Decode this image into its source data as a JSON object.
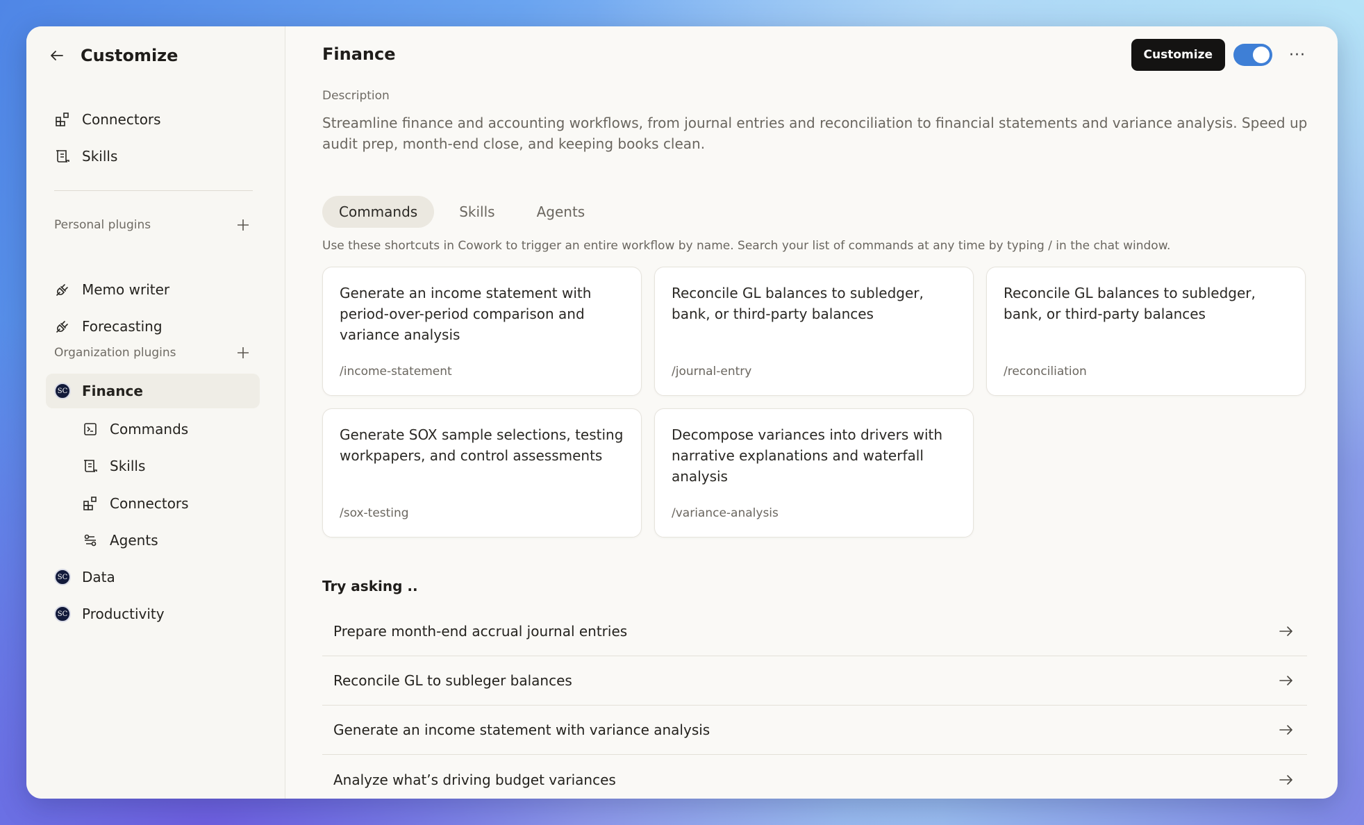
{
  "sidebar": {
    "title": "Customize",
    "top_items": [
      {
        "label": "Connectors",
        "icon": "connectors-icon"
      },
      {
        "label": "Skills",
        "icon": "skills-icon"
      }
    ],
    "personal": {
      "label": "Personal plugins",
      "items": [
        {
          "label": "Memo writer",
          "icon": "plug-icon"
        },
        {
          "label": "Forecasting",
          "icon": "plug-icon"
        }
      ]
    },
    "organization": {
      "label": "Organization plugins",
      "items": [
        {
          "label": "Finance",
          "badge": "SC",
          "active": true
        },
        {
          "label": "Data",
          "badge": "SC"
        },
        {
          "label": "Productivity",
          "badge": "SC"
        }
      ],
      "finance_sub": [
        {
          "label": "Commands",
          "icon": "commands-icon"
        },
        {
          "label": "Skills",
          "icon": "skills-icon"
        },
        {
          "label": "Connectors",
          "icon": "connectors-icon"
        },
        {
          "label": "Agents",
          "icon": "agents-icon"
        }
      ]
    }
  },
  "main": {
    "title": "Finance",
    "customize_label": "Customize",
    "toggle_on": true,
    "more_label": "···",
    "description_label": "Description",
    "description": "Streamline finance and accounting workflows, from journal entries and reconciliation to financial statements and variance analysis. Speed up audit prep, month-end close, and keeping books clean.",
    "tabs": [
      {
        "label": "Commands",
        "active": true
      },
      {
        "label": "Skills"
      },
      {
        "label": "Agents"
      }
    ],
    "tab_help": "Use these shortcuts in Cowork to trigger an entire workflow by name. Search your list of commands at any time by typing / in the chat window.",
    "cards": [
      {
        "desc": "Generate an income statement with period-over-period comparison and variance analysis",
        "cmd": "/income-statement"
      },
      {
        "desc": "Reconcile GL balances to subledger, bank, or third-party balances",
        "cmd": "/journal-entry"
      },
      {
        "desc": "Reconcile GL balances to subledger, bank, or third-party balances",
        "cmd": "/reconciliation"
      },
      {
        "desc": "Generate SOX sample selections, testing workpapers, and control assessments",
        "cmd": "/sox-testing"
      },
      {
        "desc": "Decompose variances into drivers with narrative explanations and waterfall analysis",
        "cmd": "/variance-analysis"
      }
    ],
    "try_title": "Try asking ..",
    "try_items": [
      "Prepare month-end accrual journal entries",
      "Reconcile GL to subleger balances",
      "Generate an income statement with variance analysis",
      "Analyze what’s driving budget variances"
    ]
  },
  "colors": {
    "toggle": "#3e7fd6",
    "button_dark": "#141312",
    "active_bg": "#efede6"
  }
}
